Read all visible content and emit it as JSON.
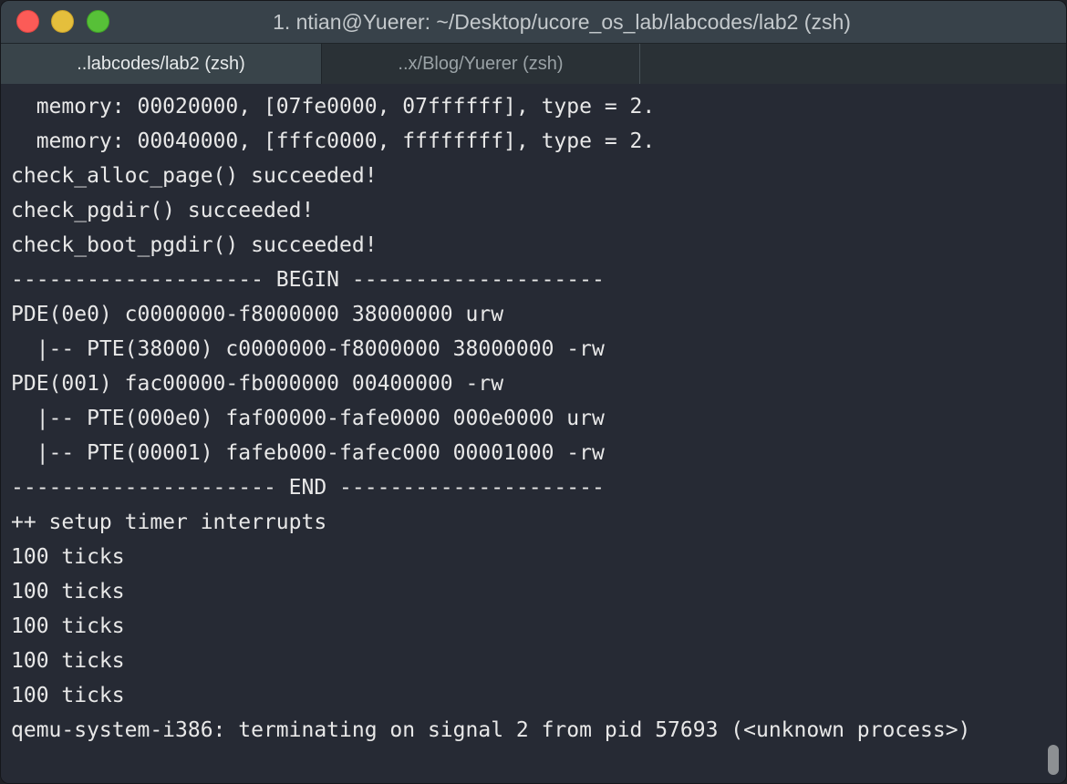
{
  "window": {
    "title": "1. ntian@Yuerer: ~/Desktop/ucore_os_lab/labcodes/lab2 (zsh)"
  },
  "tabs": [
    {
      "label": "..labcodes/lab2 (zsh)",
      "active": true
    },
    {
      "label": "..x/Blog/Yuerer (zsh)",
      "active": false
    }
  ],
  "terminal": {
    "lines": [
      "  memory: 00020000, [07fe0000, 07ffffff], type = 2.",
      "  memory: 00040000, [fffc0000, ffffffff], type = 2.",
      "check_alloc_page() succeeded!",
      "check_pgdir() succeeded!",
      "check_boot_pgdir() succeeded!",
      "-------------------- BEGIN --------------------",
      "PDE(0e0) c0000000-f8000000 38000000 urw",
      "  |-- PTE(38000) c0000000-f8000000 38000000 -rw",
      "PDE(001) fac00000-fb000000 00400000 -rw",
      "  |-- PTE(000e0) faf00000-fafe0000 000e0000 urw",
      "  |-- PTE(00001) fafeb000-fafec000 00001000 -rw",
      "--------------------- END ---------------------",
      "++ setup timer interrupts",
      "100 ticks",
      "100 ticks",
      "100 ticks",
      "100 ticks",
      "100 ticks",
      "qemu-system-i386: terminating on signal 2 from pid 57693 (<unknown process>)"
    ]
  },
  "colors": {
    "terminal_bg": "#262a34",
    "text": "#e8e8e8",
    "close": "#fc5b57",
    "minimize": "#e5bf3c",
    "maximize": "#57c038"
  }
}
